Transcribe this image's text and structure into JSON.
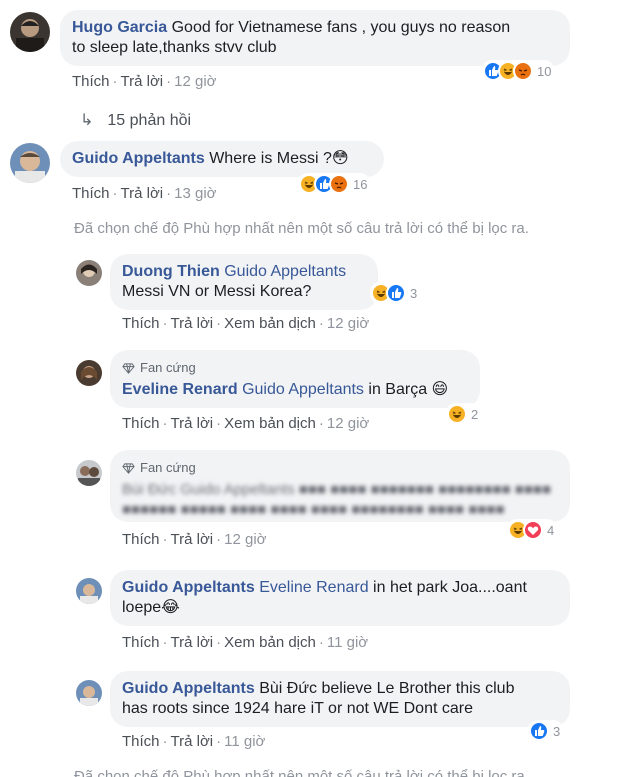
{
  "actions": {
    "like": "Thích",
    "reply": "Trả lời",
    "translate": "Xem bản dịch",
    "sep": "·"
  },
  "comments": [
    {
      "author": "Hugo Garcia",
      "text_1": "Good for Vietnamese fans , you guys no reason",
      "text_2": "to sleep late,thanks stvv club",
      "time": "12 giờ",
      "react_count": "10",
      "reactions": [
        "like-icon",
        "haha-icon",
        "angry-icon"
      ]
    },
    {
      "author": "Guido Appeltants",
      "text": "Where is Messi ?",
      "emoji": "😳",
      "time": "13 giờ",
      "react_count": "16",
      "reactions": [
        "haha-icon",
        "like-icon",
        "angry-icon"
      ]
    }
  ],
  "replies_link": "15 phản hồi",
  "notice": "Đã chọn chế độ Phù hợp nhất nên một số câu trả lời có thể bị lọc ra.",
  "replies": [
    {
      "author": "Duong Thien",
      "mention": "Guido Appeltants",
      "text": "Messi VN or Messi Korea?",
      "time": "12 giờ",
      "react_count": "3"
    },
    {
      "badge": "Fan cứng",
      "author": "Eveline Renard",
      "mention": "Guido Appeltants",
      "text": "in Barça",
      "time": "12 giờ",
      "react_count": "2"
    },
    {
      "badge": "Fan cứng",
      "blurred_1": "Bùi Đức Guido Appeltants ■■■ ■■■■ ■■■■■■■ ■■■■■■■■ ■■■■ ■■■■■■ ■■■■■ ■■■■ ■■■■ ■■■■ ■■■■■■■■ ■■■■ ■■■■",
      "time": "12 giờ",
      "react_count": "4"
    },
    {
      "author": "Guido Appeltants",
      "mention": "Eveline Renard",
      "text_1": "in het park Joa....oant",
      "text_2": "loepe",
      "time": "11 giờ"
    },
    {
      "author": "Guido Appeltants",
      "text_1": "Bùi Đức believe Le Brother this club",
      "text_2": "has roots since 1924 hare iT or not WE Dont care",
      "time": "11 giờ",
      "react_count": "3"
    }
  ],
  "notice_bottom": "Đã chọn chế độ Phù hợp nhất nên một số câu trả lời có thể bị lọc ra."
}
